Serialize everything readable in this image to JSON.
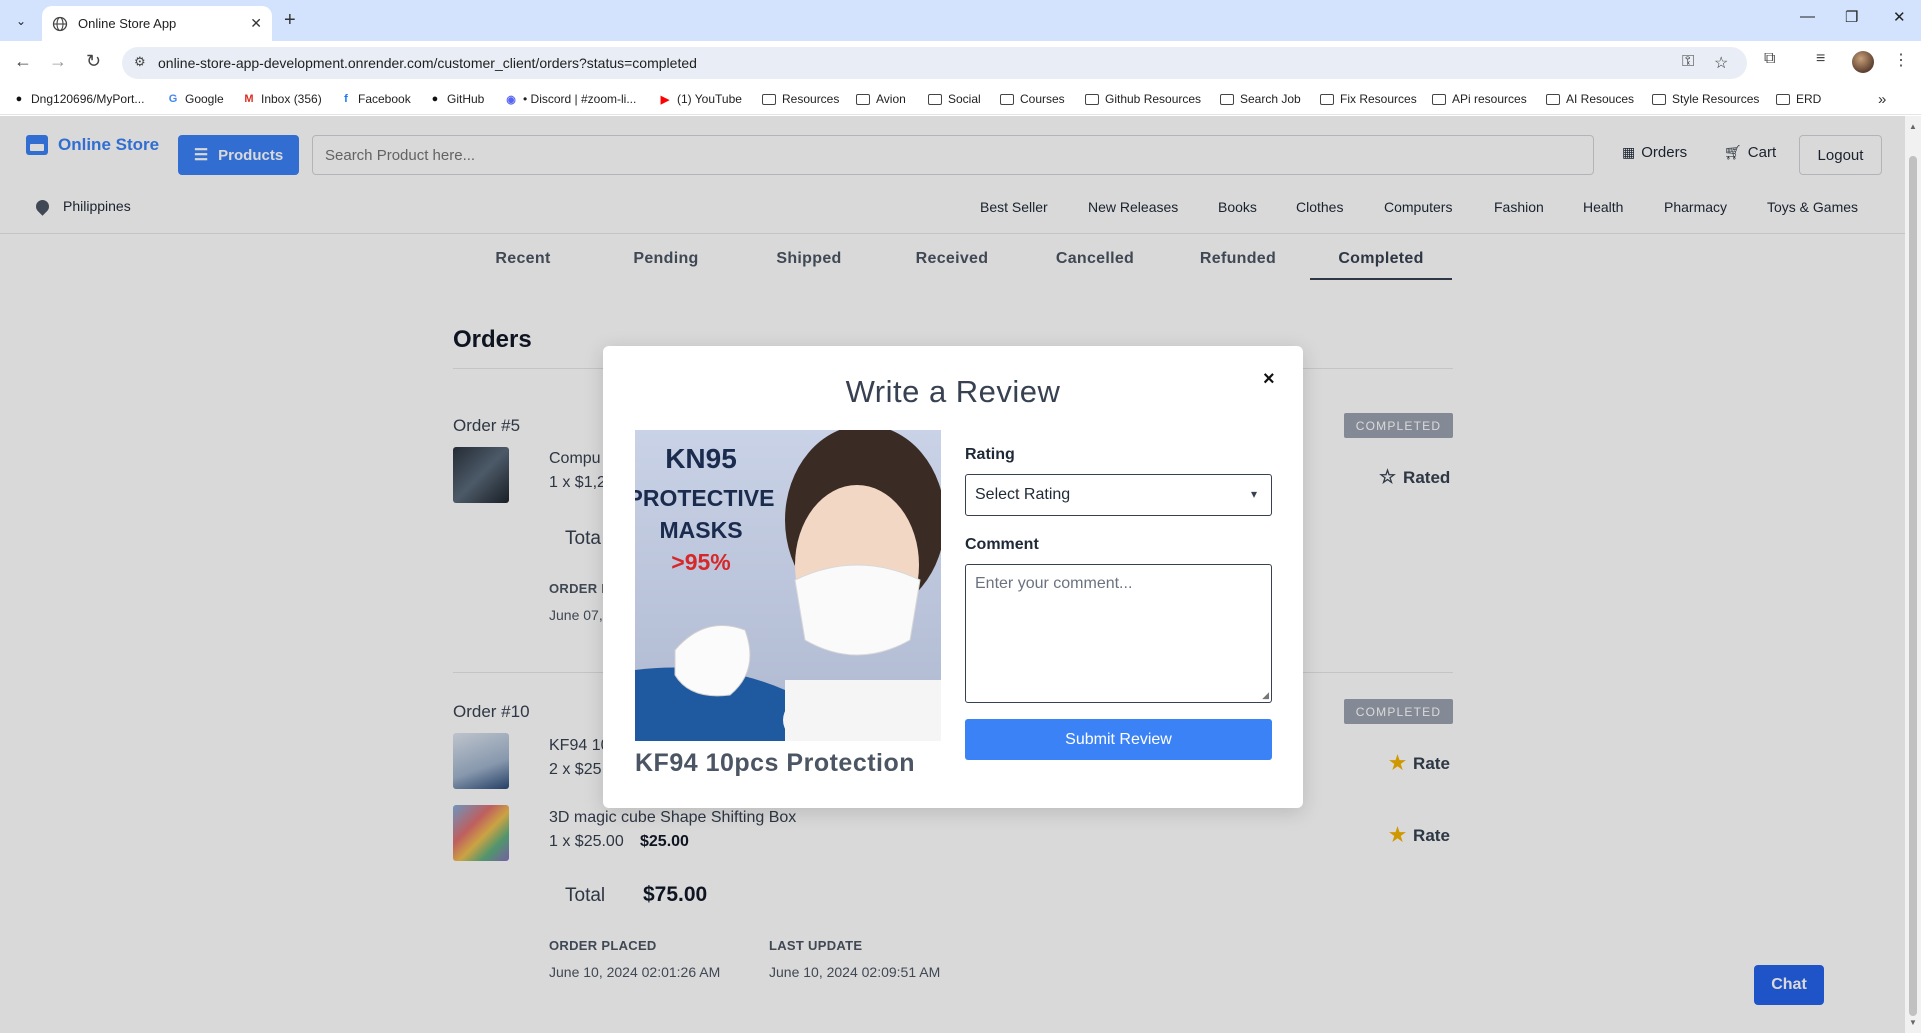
{
  "browser": {
    "tab_title": "Online Store App",
    "url": "online-store-app-development.onrender.com/customer_client/orders?status=completed",
    "bookmarks": [
      {
        "label": "Dng120696/MyPort...",
        "icon": "github-icon"
      },
      {
        "label": "Google",
        "icon": "google-icon"
      },
      {
        "label": "Inbox (356)",
        "icon": "gmail-icon"
      },
      {
        "label": "Facebook",
        "icon": "facebook-icon"
      },
      {
        "label": "GitHub",
        "icon": "github-icon"
      },
      {
        "label": "• Discord | #zoom-li...",
        "icon": "discord-icon"
      },
      {
        "label": "(1) YouTube",
        "icon": "youtube-icon"
      },
      {
        "label": "Resources",
        "icon": "folder-icon"
      },
      {
        "label": "Avion",
        "icon": "folder-icon"
      },
      {
        "label": "Social",
        "icon": "folder-icon"
      },
      {
        "label": "Courses",
        "icon": "folder-icon"
      },
      {
        "label": "Github Resources",
        "icon": "folder-icon"
      },
      {
        "label": "Search Job",
        "icon": "folder-icon"
      },
      {
        "label": "Fix Resources",
        "icon": "folder-icon"
      },
      {
        "label": "APi resources",
        "icon": "folder-icon"
      },
      {
        "label": "AI Resouces",
        "icon": "folder-icon"
      },
      {
        "label": "Style Resources",
        "icon": "folder-icon"
      },
      {
        "label": "ERD",
        "icon": "folder-icon"
      }
    ]
  },
  "header": {
    "logo": "Online Store",
    "products_btn": "Products",
    "search_placeholder": "Search Product here...",
    "orders": "Orders",
    "cart": "Cart",
    "logout": "Logout"
  },
  "subnav": {
    "location": "Philippines",
    "categories": [
      "Best Seller",
      "New Releases",
      "Books",
      "Clothes",
      "Computers",
      "Fashion",
      "Health",
      "Pharmacy",
      "Toys & Games"
    ]
  },
  "status_tabs": [
    "Recent",
    "Pending",
    "Shipped",
    "Received",
    "Cancelled",
    "Refunded",
    "Completed"
  ],
  "active_tab": "Completed",
  "orders_title": "Orders",
  "orders": [
    {
      "label": "Order #5",
      "status": "COMPLETED",
      "items": [
        {
          "name": "Compu",
          "qty": "1 x $1,2",
          "subtotal": "",
          "rate_label": "Rated",
          "star": "empty"
        }
      ],
      "total_label": "Tota",
      "total": "",
      "placed_label": "ORDER P",
      "placed": "June 07,",
      "update_label": "",
      "update": ""
    },
    {
      "label": "Order #10",
      "status": "COMPLETED",
      "items": [
        {
          "name": "KF94 10",
          "qty": "2 x $25",
          "subtotal": "",
          "rate_label": "Rate",
          "star": "filled"
        },
        {
          "name": "3D magic cube Shape Shifting Box",
          "qty": "1 x $25.00",
          "subtotal": "$25.00",
          "rate_label": "Rate",
          "star": "filled"
        }
      ],
      "total_label": "Total",
      "total": "$75.00",
      "placed_label": "ORDER PLACED",
      "placed": "June 10, 2024 02:01:26 AM",
      "update_label": "LAST UPDATE",
      "update": "June 10, 2024 02:09:51 AM"
    }
  ],
  "chat": "Chat",
  "modal": {
    "title": "Write a Review",
    "close": "×",
    "product_caption": "KF94 10pcs Protection",
    "image_text": {
      "line1": "KN95",
      "line2": "PROTECTIVE",
      "line3": "MASKS",
      "line4": ">95%"
    },
    "rating_label": "Rating",
    "rating_value": "Select Rating",
    "comment_label": "Comment",
    "comment_placeholder": "Enter your comment...",
    "submit": "Submit Review"
  },
  "colors": {
    "accent": "#3b82f6",
    "star": "#f5b301",
    "badge": "#9ca3af"
  }
}
